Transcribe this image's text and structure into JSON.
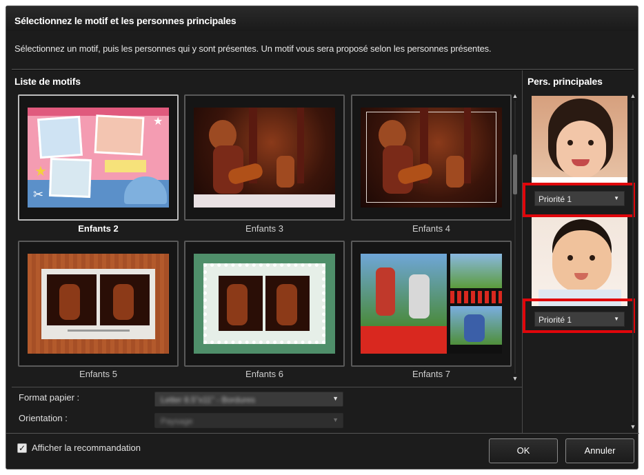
{
  "dialog": {
    "title": "Sélectionnez le motif et les personnes principales",
    "instructions": "Sélectionnez un motif, puis les personnes qui y sont présentes. Un motif vous sera proposé selon les personnes présentes."
  },
  "motifs": {
    "label": "Liste de motifs",
    "items": [
      {
        "name": "Enfants 2",
        "selected": true
      },
      {
        "name": "Enfants 3",
        "selected": false
      },
      {
        "name": "Enfants 4",
        "selected": false
      },
      {
        "name": "Enfants 5",
        "selected": false
      },
      {
        "name": "Enfants 6",
        "selected": false
      },
      {
        "name": "Enfants 7",
        "selected": false
      }
    ]
  },
  "form": {
    "paper_label": "Format papier :",
    "paper_value": "Letter 8.5\"x11\" - Bordures",
    "orientation_label": "Orientation :",
    "orientation_value": "Paysage"
  },
  "persons": {
    "label": "Pers. principales",
    "items": [
      {
        "priority": "Priorité 1"
      },
      {
        "priority": "Priorité 1"
      }
    ]
  },
  "footer": {
    "checkbox_label": "Afficher la recommandation",
    "checkbox_checked": true,
    "ok_label": "OK",
    "cancel_label": "Annuler"
  },
  "colors": {
    "highlight": "#e0060b",
    "background": "#1c1c1c"
  }
}
